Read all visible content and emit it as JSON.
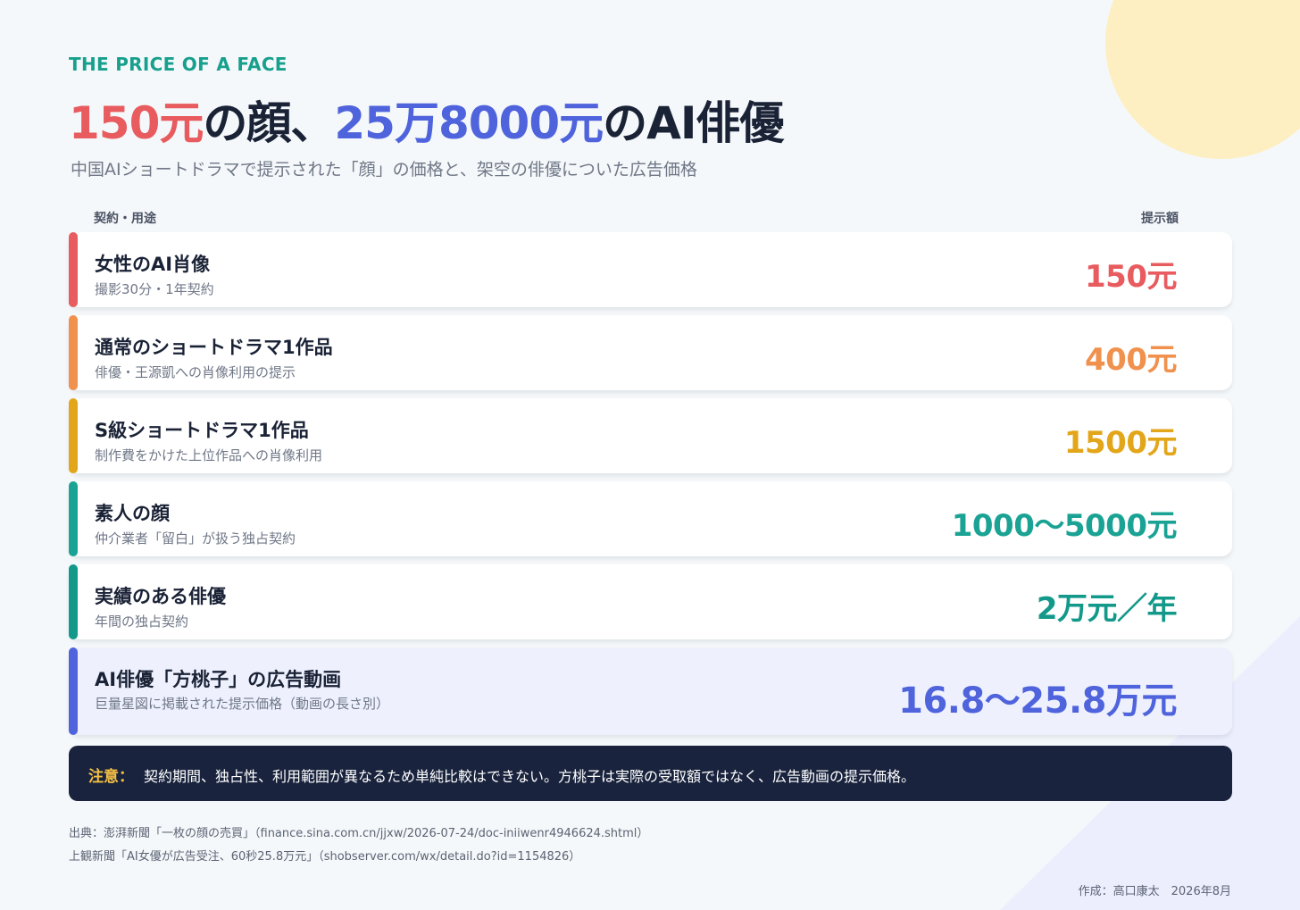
{
  "colors": {
    "teal": "#17a08d",
    "red": "#e85b5e",
    "orange": "#f0914d",
    "gold": "#e3a61a",
    "green": "#17a08d",
    "blue": "#4f63dc",
    "navy": "#19233d",
    "accent_yellow": "#f4c044"
  },
  "header": {
    "kicker": "THE PRICE OF A FACE",
    "title_parts": {
      "p1": "150元",
      "p2": "の顔、",
      "p3": "25万8000元",
      "p4": "のAI俳優"
    },
    "subtitle": "中国AIショートドラマで提示された「顔」の価格と、架空の俳優についた広告価格"
  },
  "chart_data": {
    "type": "table",
    "columns": [
      "契約・用途",
      "提示額"
    ],
    "rows": [
      {
        "label": "女性のAI肖像",
        "note": "撮影30分・1年契約",
        "price": "150元",
        "color": "#e85b5e"
      },
      {
        "label": "通常のショートドラマ1作品",
        "note": "俳優・王源凱への肖像利用の提示",
        "price": "400元",
        "color": "#f0914d"
      },
      {
        "label": "S級ショートドラマ1作品",
        "note": "制作費をかけた上位作品への肖像利用",
        "price": "1500元",
        "color": "#e3a61a"
      },
      {
        "label": "素人の顔",
        "note": "仲介業者「留白」が扱う独占契約",
        "price": "1000〜5000元",
        "color": "#1aa394"
      },
      {
        "label": "実績のある俳優",
        "note": "年間の独占契約",
        "price": "2万元／年",
        "color": "#13998a"
      },
      {
        "label": "AI俳優「方桃子」の広告動画",
        "note": "巨量星図に掲載された提示価格（動画の長さ別）",
        "price": "16.8〜25.8万元",
        "color": "#4f63dc"
      }
    ]
  },
  "notice": {
    "label": "注意：",
    "text": "契約期間、独占性、利用範囲が異なるため単純比較はできない。方桃子は実際の受取額ではなく、広告動画の提示価格。"
  },
  "sources": {
    "line1": "出典：澎湃新聞「一枚の顔の売買」（finance.sina.com.cn/jjxw/2026-07-24/doc-iniiwenr4946624.shtml）",
    "line2": "上観新聞「AI女優が広告受注、60秒25.8万元」（shobserver.com/wx/detail.do?id=1154826）"
  },
  "credit": "作成：高口康太　2026年8月"
}
